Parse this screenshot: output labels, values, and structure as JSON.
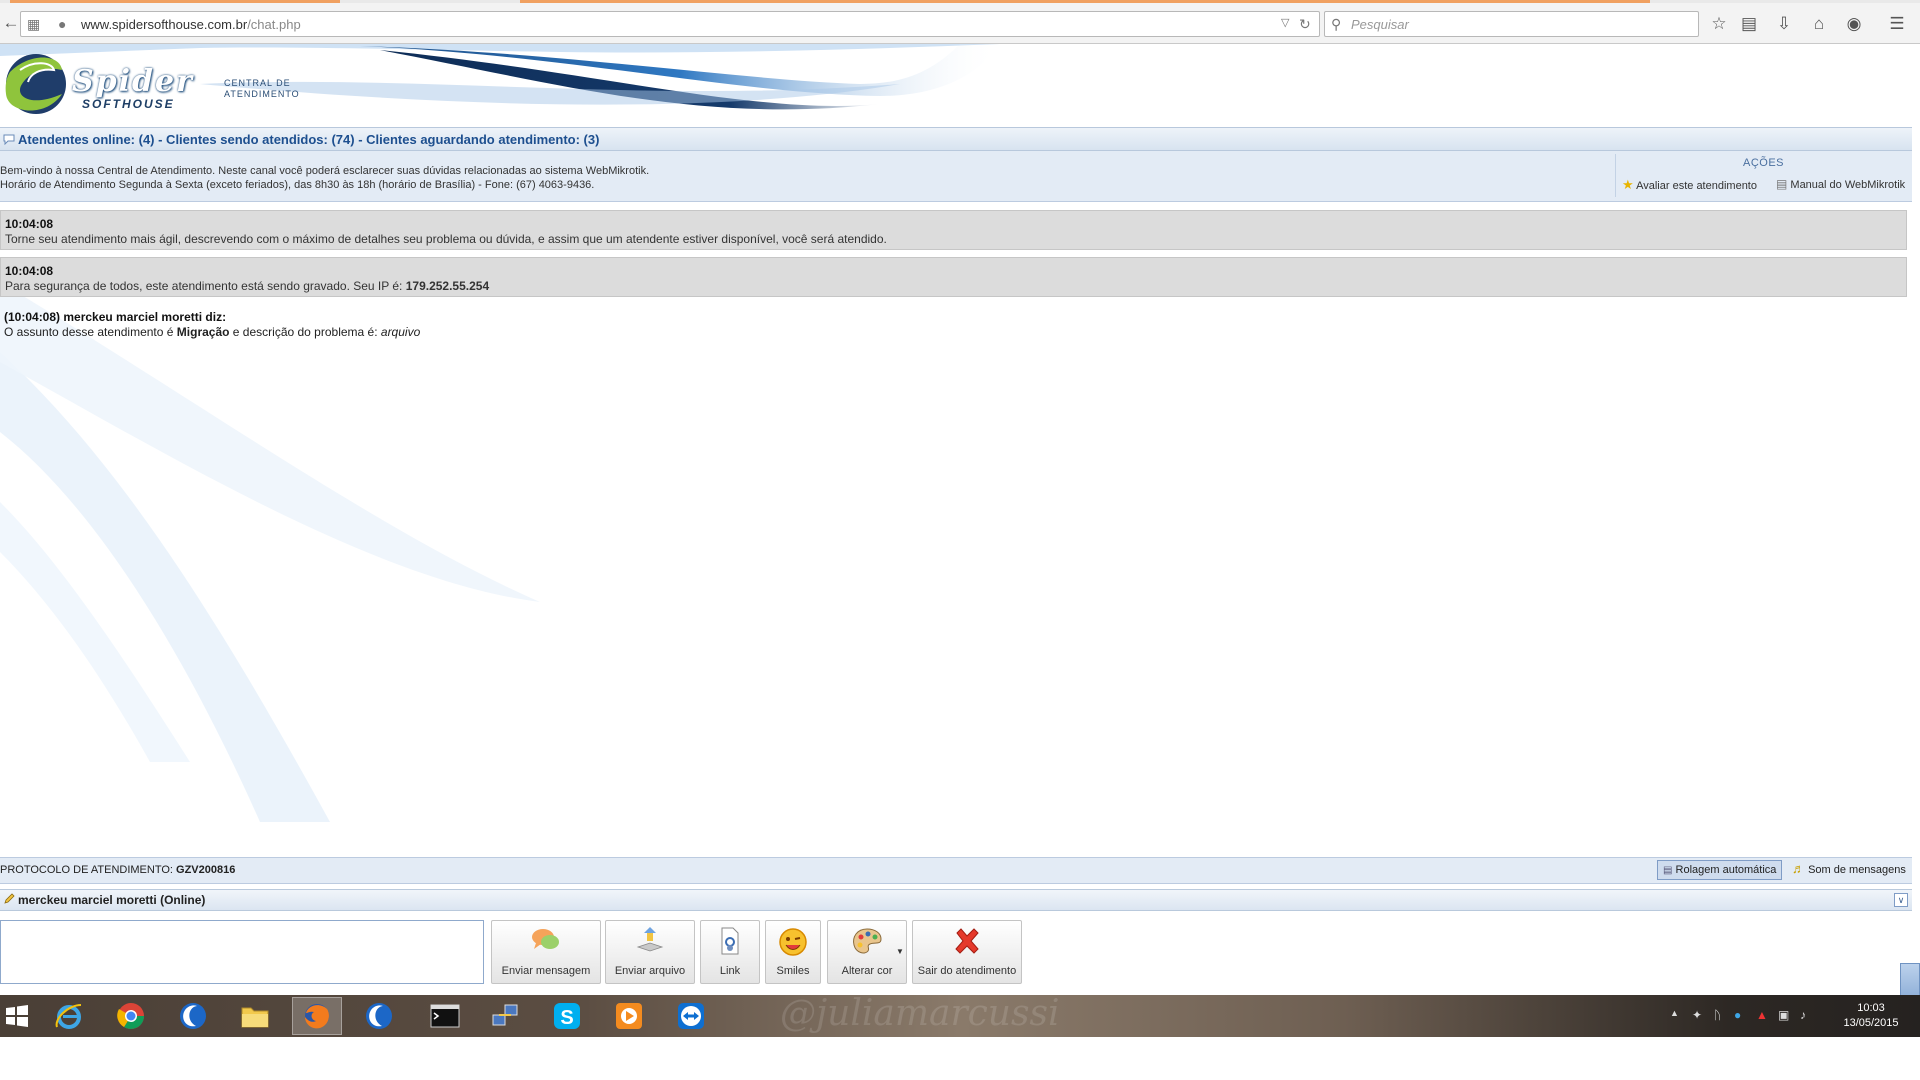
{
  "browser": {
    "url_host": "www.spidersofthouse.com.br",
    "url_path": "/chat.php",
    "search_placeholder": "Pesquisar"
  },
  "header": {
    "logo_main": "Spider",
    "logo_sub": "SOFTHOUSE",
    "central_line1": "CENTRAL DE",
    "central_line2": "ATENDIMENTO"
  },
  "status": {
    "text": "Atendentes online: (4) - Clientes sendo atendidos: (74) - Clientes aguardando atendimento: (3)"
  },
  "info": {
    "line1": "Bem-vindo à nossa Central de Atendimento. Neste canal você poderá esclarecer suas dúvidas relacionadas ao sistema WebMikrotik.",
    "line2": "Horário de Atendimento Segunda à Sexta (exceto feriados), das 8h30 às 18h (horário de Brasília) - Fone: (67) 4063-9436."
  },
  "actions": {
    "title": "AÇÕES",
    "rate": "Avaliar este atendimento",
    "manual": "Manual do WebMikrotik"
  },
  "messages": {
    "sys1_time": "10:04:08",
    "sys1_text": "Torne seu atendimento mais ágil, descrevendo com o máximo de detalhes seu problema ou dúvida, e assim que um atendente estiver disponível, você será atendido.",
    "sys2_time": "10:04:08",
    "sys2_text": "Para segurança de todos, este atendimento está sendo gravado. Seu IP é: ",
    "sys2_ip": "179.252.55.254",
    "user_head": "(10:04:08) merckeu marciel moretti diz:",
    "user_text_pre": "O assunto desse atendimento é ",
    "user_subject": "Migração",
    "user_text_mid": " e descrição do problema é: ",
    "user_desc": "arquivo"
  },
  "protocol": {
    "label": "PROTOCOLO DE ATENDIMENTO: ",
    "code": "GZV200816",
    "autoscroll": "Rolagem automática",
    "sound": "Som de mensagens"
  },
  "user": {
    "status": "merckeu marciel moretti (Online)"
  },
  "toolbar": {
    "send": "Enviar mensagem",
    "file": "Enviar arquivo",
    "link": "Link",
    "smiles": "Smiles",
    "color": "Alterar cor",
    "exit": "Sair do atendimento"
  },
  "taskbar": {
    "time": "10:03",
    "date": "13/05/2015",
    "watermark": "@juliamarcussi"
  },
  "colors": {
    "accent_blue": "#1d4f8f",
    "panel_bg": "#e3ebf5",
    "system_msg_bg": "#dcdcdc"
  }
}
